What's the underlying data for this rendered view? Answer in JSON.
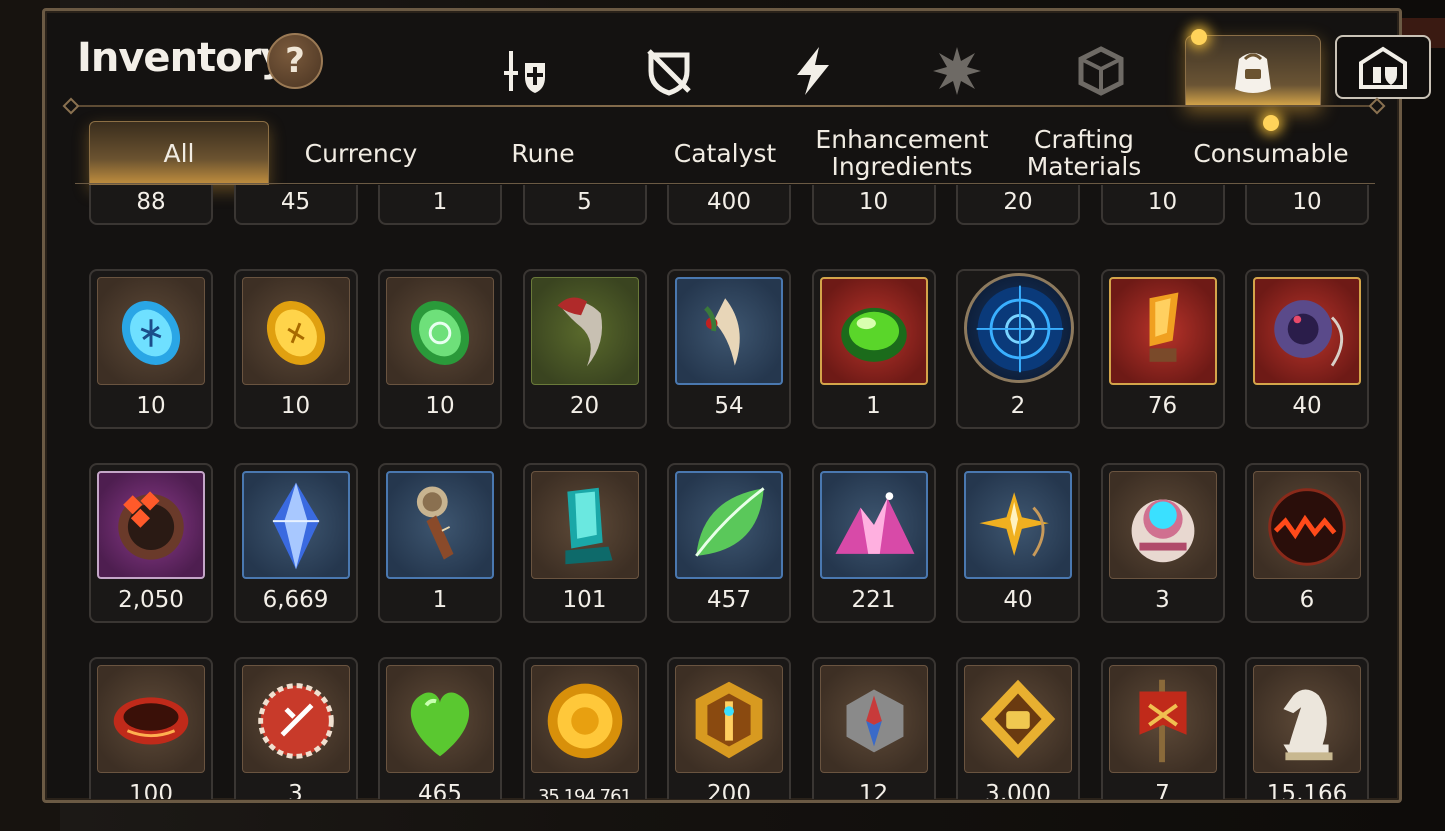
{
  "window": {
    "title": "Inventory",
    "help_label": "?"
  },
  "categories": [
    {
      "icon": "hero-gear-icon",
      "active": false
    },
    {
      "icon": "shield-disabled-icon",
      "active": false
    },
    {
      "icon": "lightning-icon",
      "active": false
    },
    {
      "icon": "burst-icon",
      "active": false
    },
    {
      "icon": "cube-icon",
      "active": false
    },
    {
      "icon": "backpack-icon",
      "active": true
    },
    {
      "icon": "castle-shop-icon",
      "active": false
    }
  ],
  "tabs": [
    {
      "label": "All",
      "active": true
    },
    {
      "label": "Currency",
      "active": false
    },
    {
      "label": "Rune",
      "active": false
    },
    {
      "label": "Catalyst",
      "active": false
    },
    {
      "label": "Enhancement Ingredients",
      "active": false
    },
    {
      "label": "Crafting Materials",
      "active": false
    },
    {
      "label": "Consumable",
      "active": false
    }
  ],
  "rows": [
    {
      "items": [
        {
          "qty": "88"
        },
        {
          "qty": "45"
        },
        {
          "qty": "1"
        },
        {
          "qty": "5"
        },
        {
          "qty": "400"
        },
        {
          "qty": "10"
        },
        {
          "qty": "20"
        },
        {
          "qty": "10"
        },
        {
          "qty": "10"
        }
      ]
    },
    {
      "items": [
        {
          "qty": "10",
          "icon": "blue-rune-icon",
          "frame": "brown"
        },
        {
          "qty": "10",
          "icon": "yellow-rune-icon",
          "frame": "brown"
        },
        {
          "qty": "10",
          "icon": "green-rune-icon",
          "frame": "brown"
        },
        {
          "qty": "20",
          "icon": "beast-claw-icon",
          "frame": "green"
        },
        {
          "qty": "54",
          "icon": "feather-root-icon",
          "frame": "blue"
        },
        {
          "qty": "1",
          "icon": "green-orb-icon",
          "frame": "red"
        },
        {
          "qty": "2",
          "icon": "rune-circle-icon",
          "frame": "round"
        },
        {
          "qty": "76",
          "icon": "amber-crystal-icon",
          "frame": "red"
        },
        {
          "qty": "40",
          "icon": "amulet-ring-icon",
          "frame": "red"
        }
      ]
    },
    {
      "items": [
        {
          "qty": "2,050",
          "icon": "hero-ring-icon",
          "frame": "purple"
        },
        {
          "qty": "6,669",
          "icon": "blue-gem-icon",
          "frame": "blue"
        },
        {
          "qty": "1",
          "icon": "compass-key-icon",
          "frame": "blue"
        },
        {
          "qty": "101",
          "icon": "teal-crystal-icon",
          "frame": "brown"
        },
        {
          "qty": "457",
          "icon": "leaf-icon",
          "frame": "blue"
        },
        {
          "qty": "221",
          "icon": "pink-ore-icon",
          "frame": "blue"
        },
        {
          "qty": "40",
          "icon": "star-amulet-icon",
          "frame": "blue"
        },
        {
          "qty": "3",
          "icon": "robot-capsule-icon",
          "frame": "brown"
        },
        {
          "qty": "6",
          "icon": "lava-orb-icon",
          "frame": "brown"
        }
      ]
    },
    {
      "items": [
        {
          "qty": "100",
          "icon": "red-bracelet-icon",
          "frame": "brown"
        },
        {
          "qty": "3",
          "icon": "red-badge-icon",
          "frame": "brown"
        },
        {
          "qty": "465",
          "icon": "green-heart-icon",
          "frame": "brown"
        },
        {
          "qty": "35,194,761",
          "icon": "gold-coin-icon",
          "frame": "brown",
          "small": true
        },
        {
          "qty": "200",
          "icon": "gold-emblem-icon",
          "frame": "brown"
        },
        {
          "qty": "12",
          "icon": "stone-compass-icon",
          "frame": "brown"
        },
        {
          "qty": "3,000",
          "icon": "fist-badge-icon",
          "frame": "brown"
        },
        {
          "qty": "7",
          "icon": "war-banner-icon",
          "frame": "brown"
        },
        {
          "qty": "15,166",
          "icon": "chess-knight-icon",
          "frame": "brown"
        }
      ]
    }
  ],
  "colors": {
    "accent": "#d6a64a",
    "panel_border": "#6b5a44",
    "text": "#f3efe8"
  }
}
